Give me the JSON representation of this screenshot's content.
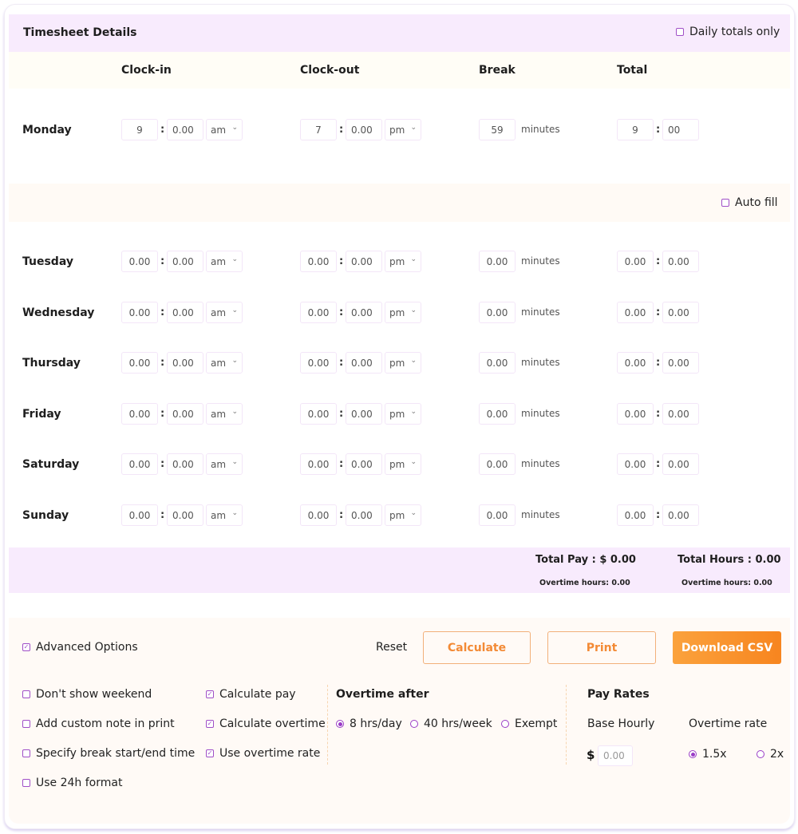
{
  "header": {
    "title": "Timesheet Details",
    "daily_totals_label": "Daily totals only",
    "daily_totals_checked": false
  },
  "columns": {
    "clock_in": "Clock-in",
    "clock_out": "Clock-out",
    "break": "Break",
    "total": "Total"
  },
  "minutes_label": "minutes",
  "autofill": {
    "label": "Auto fill",
    "checked": false
  },
  "days": [
    {
      "name": "Monday",
      "in_h": "9",
      "in_m": "0.00",
      "in_ampm": "am",
      "out_h": "7",
      "out_m": "0.00",
      "out_ampm": "pm",
      "break": "59",
      "tot_h": "9",
      "tot_m": "00"
    },
    {
      "name": "Tuesday",
      "in_h": "0.00",
      "in_m": "0.00",
      "in_ampm": "am",
      "out_h": "0.00",
      "out_m": "0.00",
      "out_ampm": "pm",
      "break": "0.00",
      "tot_h": "0.00",
      "tot_m": "0.00"
    },
    {
      "name": "Wednesday",
      "in_h": "0.00",
      "in_m": "0.00",
      "in_ampm": "am",
      "out_h": "0.00",
      "out_m": "0.00",
      "out_ampm": "pm",
      "break": "0.00",
      "tot_h": "0.00",
      "tot_m": "0.00"
    },
    {
      "name": "Thursday",
      "in_h": "0.00",
      "in_m": "0.00",
      "in_ampm": "am",
      "out_h": "0.00",
      "out_m": "0.00",
      "out_ampm": "pm",
      "break": "0.00",
      "tot_h": "0.00",
      "tot_m": "0.00"
    },
    {
      "name": "Friday",
      "in_h": "0.00",
      "in_m": "0.00",
      "in_ampm": "am",
      "out_h": "0.00",
      "out_m": "0.00",
      "out_ampm": "pm",
      "break": "0.00",
      "tot_h": "0.00",
      "tot_m": "0.00"
    },
    {
      "name": "Saturday",
      "in_h": "0.00",
      "in_m": "0.00",
      "in_ampm": "am",
      "out_h": "0.00",
      "out_m": "0.00",
      "out_ampm": "pm",
      "break": "0.00",
      "tot_h": "0.00",
      "tot_m": "0.00"
    },
    {
      "name": "Sunday",
      "in_h": "0.00",
      "in_m": "0.00",
      "in_ampm": "am",
      "out_h": "0.00",
      "out_m": "0.00",
      "out_ampm": "pm",
      "break": "0.00",
      "tot_h": "0.00",
      "tot_m": "0.00"
    }
  ],
  "totals": {
    "total_pay": "Total Pay : $ 0.00",
    "total_hours": "Total Hours : 0.00",
    "pay_overtime": "Overtime hours: 0.00",
    "hours_overtime": "Overtime hours: 0.00"
  },
  "advanced": {
    "label": "Advanced Options",
    "checked": true,
    "reset": "Reset",
    "calculate": "Calculate",
    "print": "Print",
    "download": "Download CSV",
    "options_col1": [
      {
        "label": "Don't show weekend",
        "checked": false
      },
      {
        "label": "Add custom note in print",
        "checked": false
      },
      {
        "label": "Specify break start/end time",
        "checked": false
      },
      {
        "label": "Use 24h format",
        "checked": false
      }
    ],
    "options_col2": [
      {
        "label": "Calculate pay",
        "checked": true
      },
      {
        "label": "Calculate overtime",
        "checked": true
      },
      {
        "label": "Use overtime rate",
        "checked": true
      }
    ],
    "overtime_after": {
      "title": "Overtime after",
      "options": [
        {
          "label": "8 hrs/day",
          "selected": true
        },
        {
          "label": "40 hrs/week",
          "selected": false
        },
        {
          "label": "Exempt",
          "selected": false
        }
      ]
    },
    "pay_rates": {
      "title": "Pay Rates",
      "base_label": "Base Hourly",
      "currency": "$",
      "base_placeholder": "0.00",
      "overtime_label": "Overtime rate",
      "rates": [
        {
          "label": "1.5x",
          "selected": true
        },
        {
          "label": "2x",
          "selected": false
        }
      ]
    }
  },
  "colors": {
    "accent_purple": "#9a3cc6",
    "accent_orange": "#f7851f",
    "header_bg": "#f8ebfd"
  }
}
